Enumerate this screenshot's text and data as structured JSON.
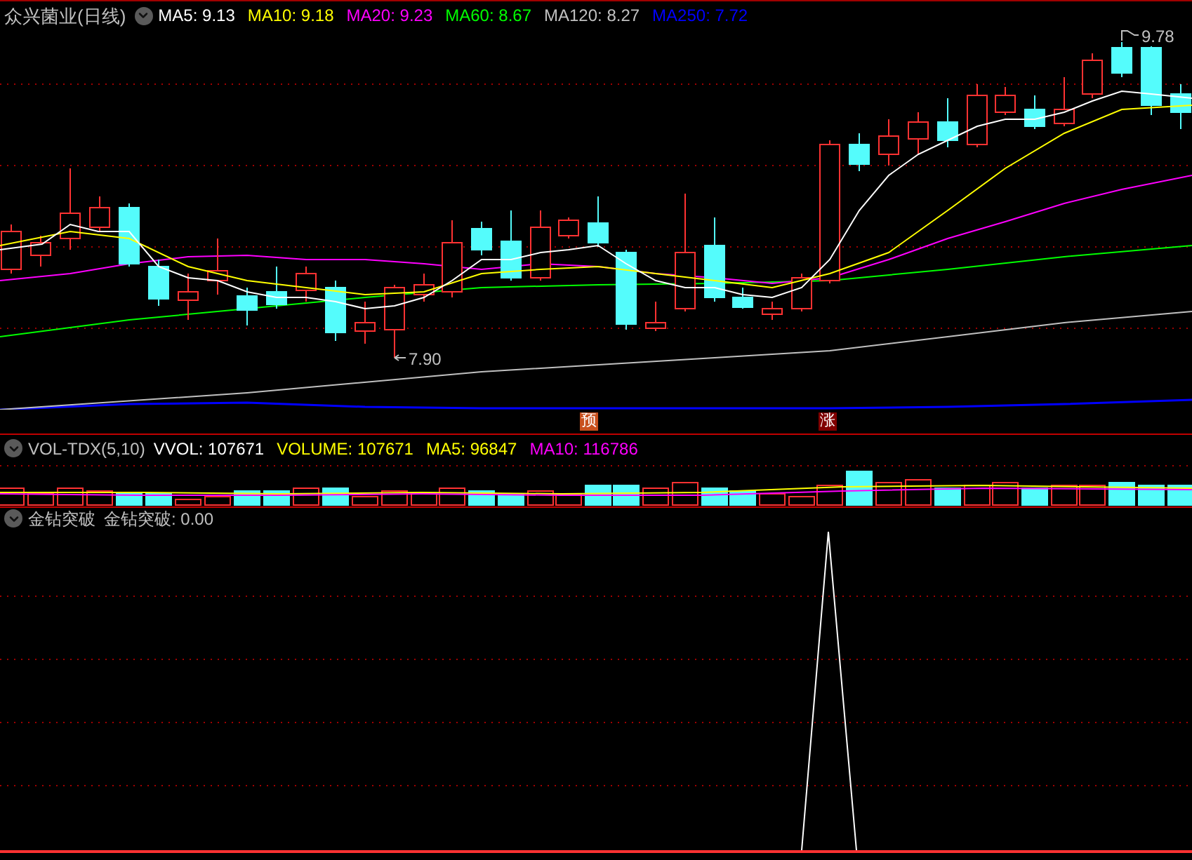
{
  "main_panel": {
    "title": "众兴菌业(日线)",
    "legend": [
      {
        "text": "MA5: 9.13",
        "color": "#ffffff"
      },
      {
        "text": "MA10: 9.18",
        "color": "#ffff00"
      },
      {
        "text": "MA20: 9.23",
        "color": "#ff00ff"
      },
      {
        "text": "MA60: 8.67",
        "color": "#00ff00"
      },
      {
        "text": "MA120: 8.27",
        "color": "#c0c0c0"
      },
      {
        "text": "MA250: 7.72",
        "color": "#0000ff"
      }
    ],
    "high_label": "9.78",
    "low_label": "7.90",
    "markers": [
      {
        "text": "预",
        "color": "#c8501e"
      },
      {
        "text": "涨",
        "color": "#800000"
      }
    ]
  },
  "volume_panel": {
    "name": "VOL-TDX(5,10)",
    "legend": [
      {
        "text": "VVOL: 107671",
        "color": "#ffffff"
      },
      {
        "text": "VOLUME: 107671",
        "color": "#ffff00"
      },
      {
        "text": "MA5: 96847",
        "color": "#ffff00"
      },
      {
        "text": "MA10: 116786",
        "color": "#ff00ff"
      }
    ]
  },
  "indicator_panel": {
    "name": "金钻突破",
    "legend": [
      {
        "text": "金钻突破: 0.00",
        "color": "#c0c0c0"
      }
    ]
  }
}
